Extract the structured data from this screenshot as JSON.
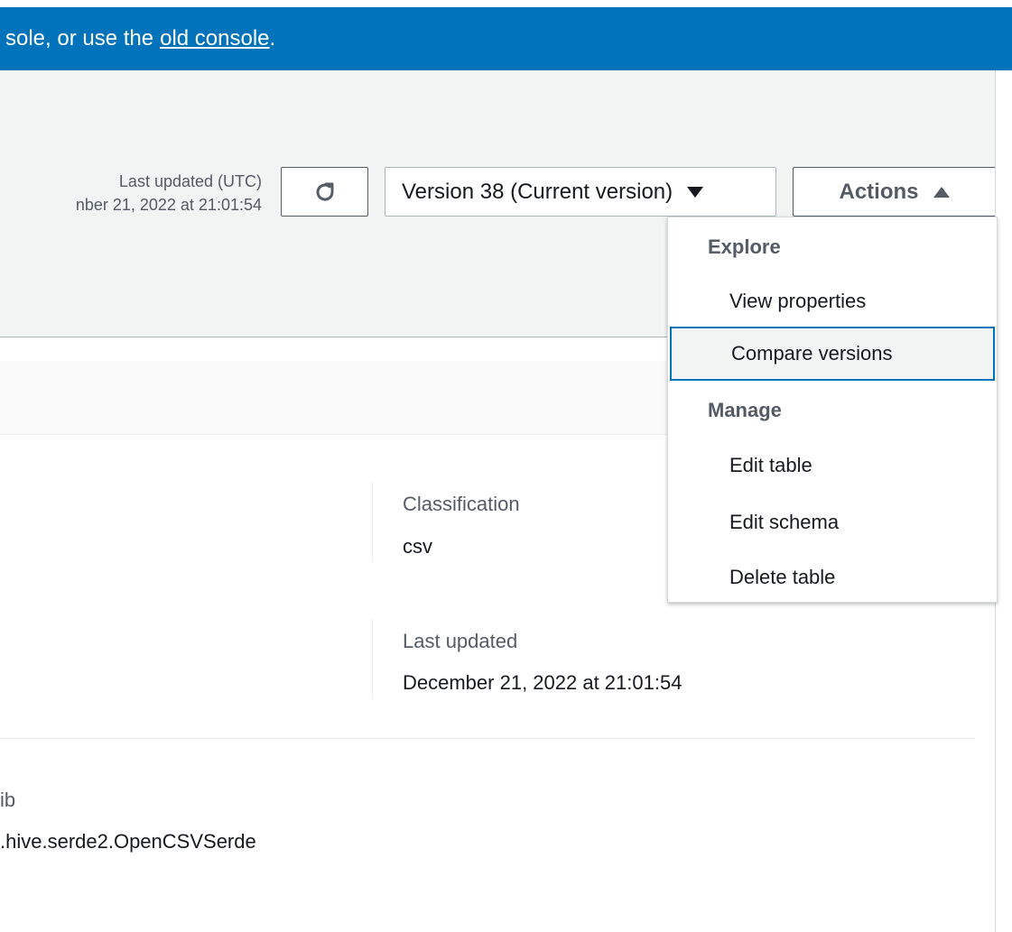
{
  "banner": {
    "text_prefix": "sole, or use the",
    "link_label": "old console",
    "text_suffix": "."
  },
  "header": {
    "last_updated_label": "Last updated (UTC)",
    "last_updated_value": "nber 21, 2022 at 21:01:54",
    "refresh_icon": "refresh-icon",
    "version_select": "Version 38 (Current version)",
    "actions_label": "Actions"
  },
  "actions_menu": {
    "groups": [
      {
        "label": "Explore",
        "items": [
          "View properties",
          "Compare versions"
        ]
      },
      {
        "label": "Manage",
        "items": [
          "Edit table",
          "Edit schema",
          "Delete table"
        ]
      }
    ]
  },
  "details": {
    "classification_label": "Classification",
    "classification_value": "csv",
    "last_updated_label": "Last updated",
    "last_updated_value": "December 21, 2022 at 21:01:54",
    "serde_label": "ib",
    "serde_value": ".hive.serde2.OpenCSVSerde"
  }
}
